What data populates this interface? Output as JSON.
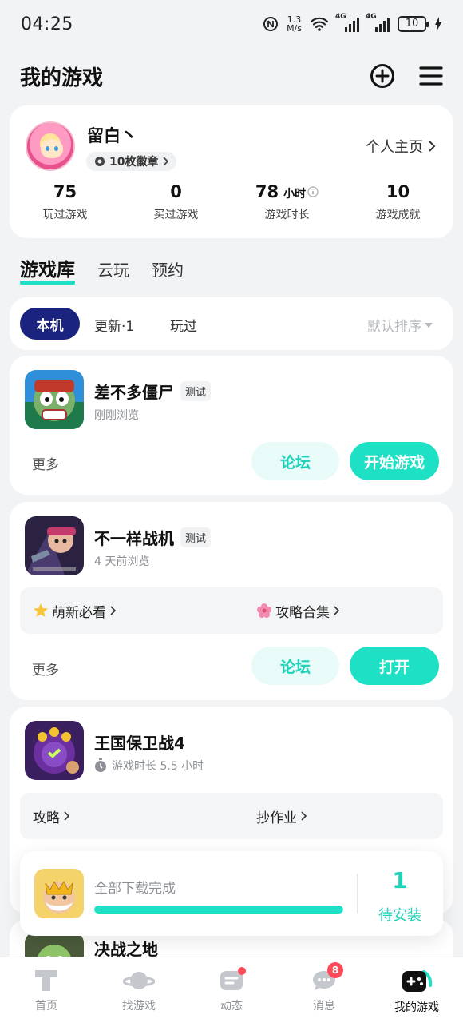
{
  "status_bar": {
    "time": "04:25",
    "speed_value": "1.3",
    "speed_unit": "M/s",
    "network1": "4G",
    "network2": "4G",
    "battery": "10"
  },
  "header": {
    "title": "我的游戏"
  },
  "profile": {
    "nickname": "留白丶",
    "badges": "10枚徽章",
    "homepage": "个人主页",
    "stats": [
      {
        "value": "75",
        "unit": "",
        "label": "玩过游戏"
      },
      {
        "value": "0",
        "unit": "",
        "label": "买过游戏"
      },
      {
        "value": "78",
        "unit": "小时",
        "label": "游戏时长"
      },
      {
        "value": "10",
        "unit": "",
        "label": "游戏成就"
      }
    ]
  },
  "tabs": [
    "游戏库",
    "云玩",
    "预约"
  ],
  "filter": {
    "options": [
      "本机",
      "更新·1",
      "玩过"
    ],
    "sort": "默认排序"
  },
  "games": [
    {
      "name": "差不多僵尸",
      "tag": "测试",
      "sub": "刚刚浏览",
      "more": "更多",
      "forum": "论坛",
      "primary": "开始游戏"
    },
    {
      "name": "不一样战机",
      "tag": "测试",
      "sub": "4 天前浏览",
      "links": [
        "萌新必看",
        "攻略合集"
      ],
      "more": "更多",
      "forum": "论坛",
      "primary": "打开"
    },
    {
      "name": "王国保卫战4",
      "sub": "游戏时长 5.5 小时",
      "links": [
        "攻略",
        "抄作业"
      ]
    },
    {
      "name": "决战之地"
    }
  ],
  "download": {
    "text": "全部下载完成",
    "progress": 1.0,
    "count": "1",
    "count_label": "待安装"
  },
  "nav": [
    {
      "label": "首页",
      "icon": "home-icon"
    },
    {
      "label": "找游戏",
      "icon": "planet-icon"
    },
    {
      "label": "动态",
      "icon": "feed-icon",
      "dot": true
    },
    {
      "label": "消息",
      "icon": "message-icon",
      "badge": "8"
    },
    {
      "label": "我的游戏",
      "icon": "gamepad-icon",
      "active": true
    }
  ],
  "colors": {
    "accent": "#1ee0c4",
    "active_pill": "#1a237e",
    "badge_red": "#ff4a5a"
  }
}
